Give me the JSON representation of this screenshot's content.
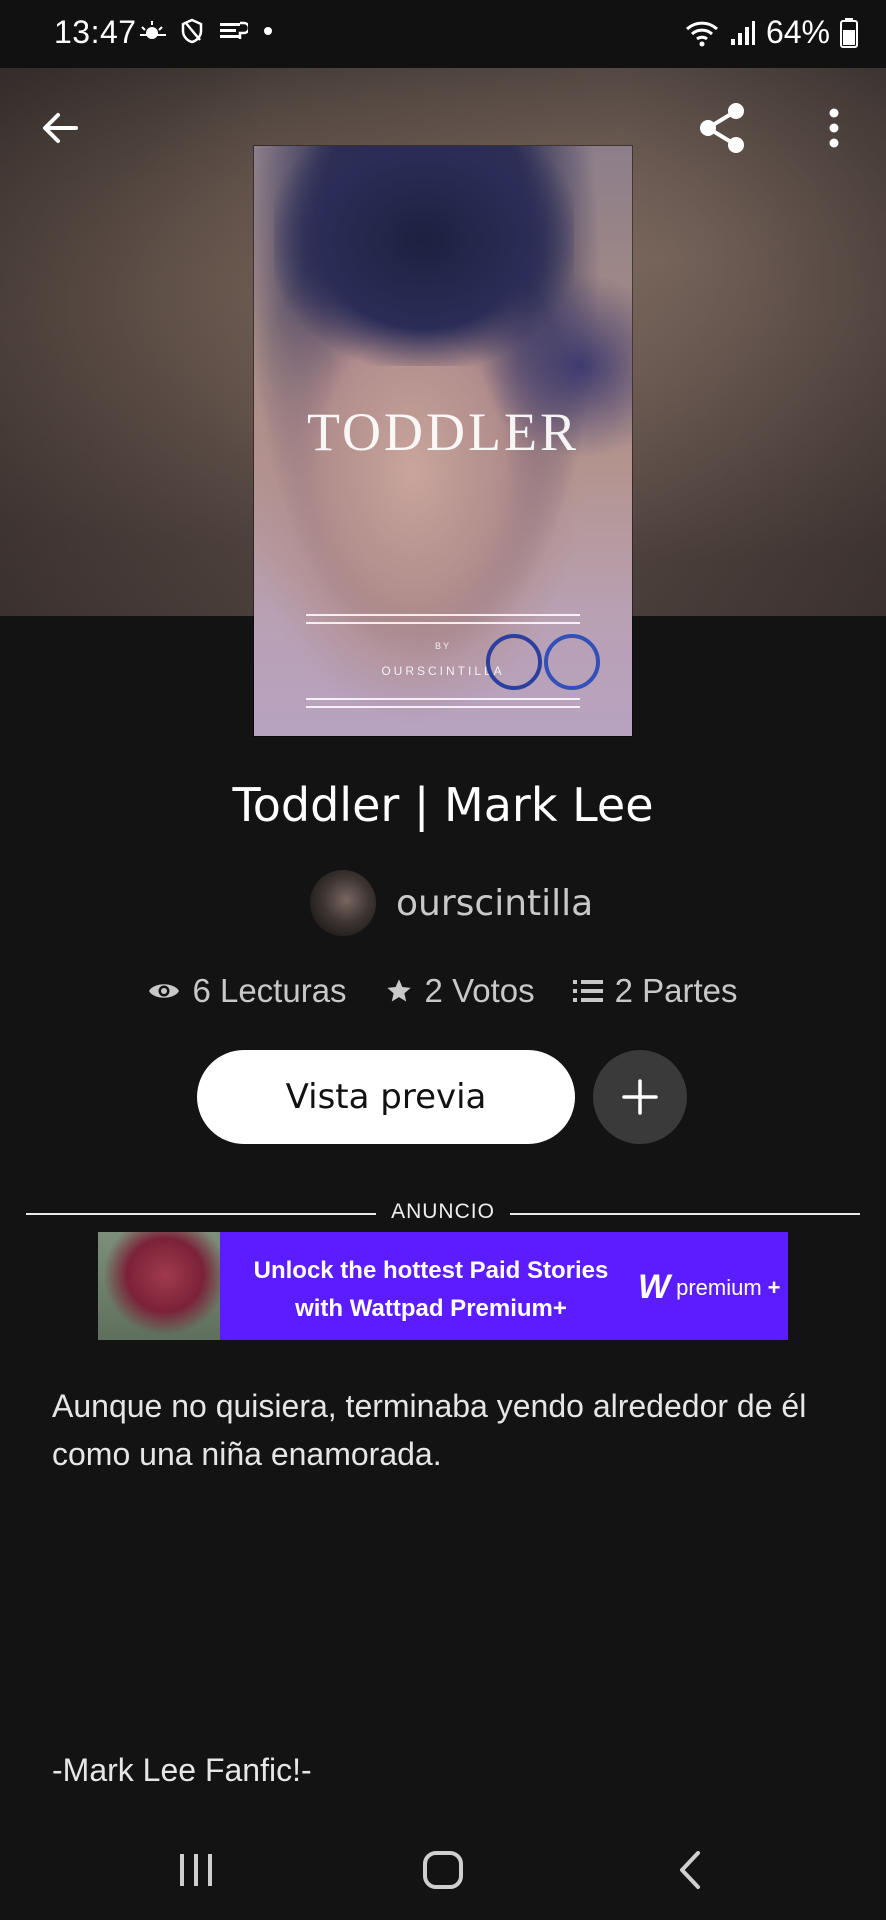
{
  "status_bar": {
    "time": "13:47",
    "battery": "64%",
    "left_icons": [
      "weather-icon",
      "shield-icon",
      "notification-icon",
      "dot-icon"
    ],
    "right_icons": [
      "wifi-icon",
      "signal-icon",
      "battery-icon"
    ]
  },
  "header": {
    "back_icon": "arrow-left-icon",
    "share_icon": "share-icon",
    "more_icon": "more-vertical-icon"
  },
  "cover": {
    "title": "TODDLER",
    "by": "BY",
    "author": "OURSCINTILLA"
  },
  "story": {
    "title": "Toddler | Mark Lee",
    "author": "ourscintilla"
  },
  "stats": {
    "reads": "6 Lecturas",
    "votes": "2 Votos",
    "parts": "2 Partes"
  },
  "actions": {
    "preview_label": "Vista previa",
    "add_icon": "plus-icon"
  },
  "ad": {
    "label": "ANUNCIO",
    "line1": "Unlock the hottest Paid Stories",
    "line2": "with Wattpad Premium+",
    "brand_letter": "W",
    "brand": "premium",
    "brand_suffix": "+"
  },
  "description": "Aunque no quisiera, terminaba yendo alrededor de él como una niña enamorada.",
  "tagline": "-Mark Lee Fanfic!-",
  "colors": {
    "background": "#141314",
    "ad_background": "#5b1dff",
    "button_white": "#ffffff",
    "add_button": "#3a3a3a"
  }
}
